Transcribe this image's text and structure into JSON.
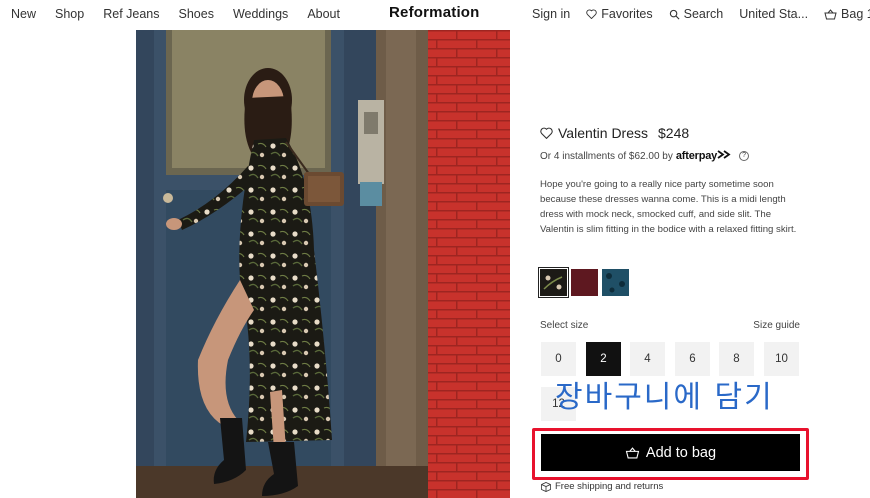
{
  "nav": {
    "left": [
      "New",
      "Shop",
      "Ref Jeans",
      "Shoes",
      "Weddings",
      "About"
    ],
    "logo": "Reformation",
    "sign_in": "Sign in",
    "favorites": "Favorites",
    "search": "Search",
    "region": "United Sta...",
    "bag": "Bag 1"
  },
  "product": {
    "name": "Valentin Dress",
    "price": "$248",
    "installments": "Or 4 installments of $62.00 by",
    "afterpay_logo": "afterpay",
    "description": "Hope you're going to a really nice party sometime soon because these dresses wanna come. This is a midi length dress with mock neck, smocked cuff, and side slit. The Valentin is slim fitting in the bodice with a relaxed fitting skirt.",
    "swatches": [
      {
        "name": "black floral",
        "color": "#1c1a16",
        "selected": true
      },
      {
        "name": "burgundy",
        "color": "#5e1820",
        "selected": false
      },
      {
        "name": "teal",
        "color": "#1f4f66",
        "selected": false
      }
    ],
    "select_size_label": "Select size",
    "size_guide_label": "Size guide",
    "sizes": [
      "0",
      "2",
      "4",
      "6",
      "8",
      "10",
      "12"
    ],
    "selected_size": "2",
    "add_to_bag": "Add to bag",
    "shipping": "Free shipping and returns"
  },
  "overlay": {
    "korean_label": "장바구니에 담기"
  },
  "colors": {
    "highlight": "#e8122d",
    "overlay_text": "#2a69c8"
  }
}
